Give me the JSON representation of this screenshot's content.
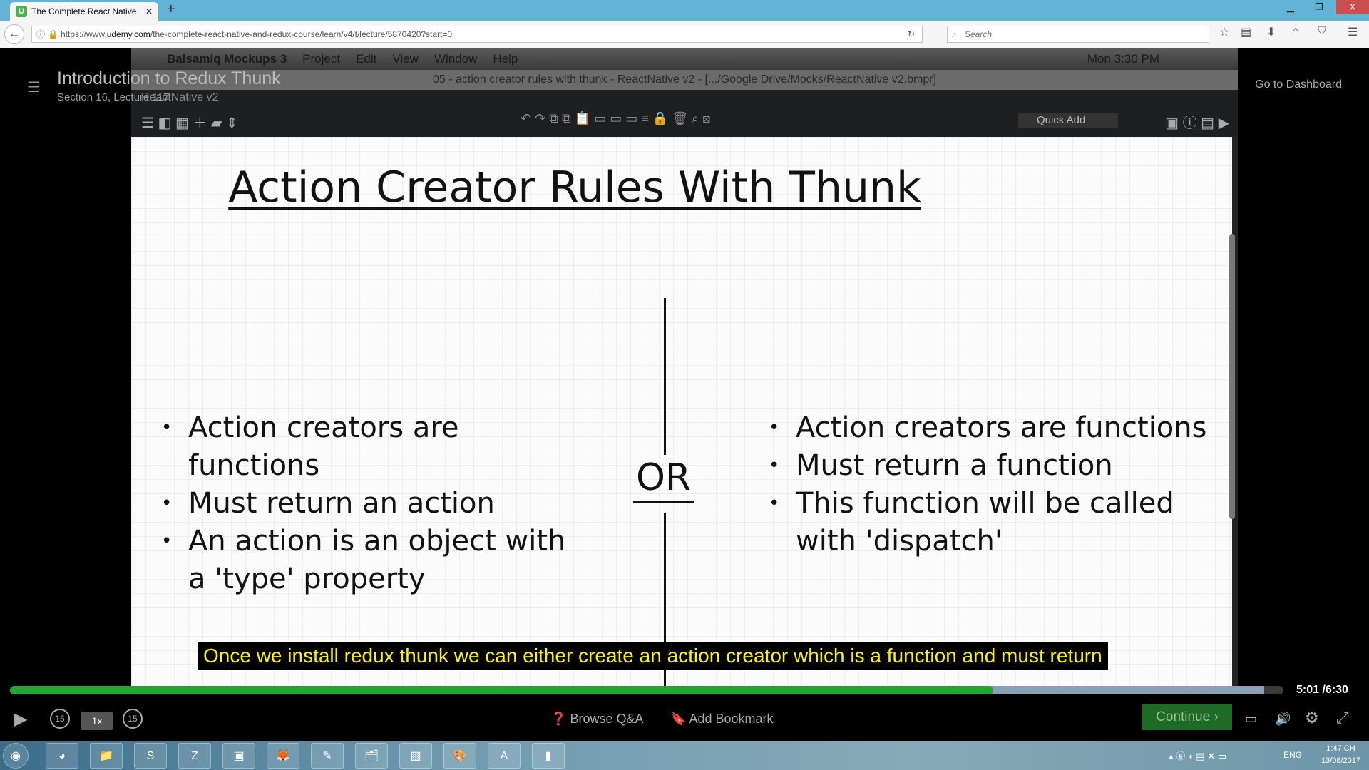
{
  "browser": {
    "tab_title": "The Complete React Native",
    "new_tab": "+",
    "url_prefix": "https://www.",
    "url_domain": "udemy.com",
    "url_path": "/the-complete-react-native-and-redux-course/learn/v4/t/lecture/5870420?start=0",
    "search_placeholder": "Search",
    "close": "X"
  },
  "course": {
    "lesson_title": "Introduction to Redux Thunk",
    "section": "Section 16, Lecture 117",
    "go_dashboard": "Go to Dashboard"
  },
  "mac": {
    "apple": "",
    "app": "Balsamiq Mockups 3",
    "menus": [
      "Project",
      "Edit",
      "View",
      "Window",
      "Help"
    ],
    "clock": "Mon 3:30 PM",
    "window_title": "05 - action creator rules with thunk - ReactNative v2 - [.../Google Drive/Mocks/ReactNative v2.bmpr]",
    "project_name": "ReactNative v2",
    "quick_add": "Quick Add"
  },
  "slide": {
    "title": "Action Creator Rules With Thunk",
    "or": "OR",
    "left": [
      "Action creators are functions",
      "Must return an action",
      "An action is an object with a 'type' property"
    ],
    "right": [
      "Action creators are functions",
      "Must return a function",
      "This function will be called with 'dispatch'"
    ]
  },
  "player": {
    "subtitle": "Once we install redux thunk we can either create an action creator which is a function and must return",
    "current_time": "5:01",
    "duration": "/6:30",
    "played_fraction": 0.772,
    "buffered_fraction": 0.985,
    "speed": "1x",
    "rewind": "15",
    "forward": "15",
    "browse_qa": "Browse Q&A",
    "add_bookmark": "Add Bookmark",
    "continue": "Continue"
  },
  "taskbar": {
    "apps": [
      "chrome",
      "explorer",
      "skype",
      "zalo",
      "hub",
      "firefox",
      "notepad",
      "files",
      "photos",
      "paint",
      "android-studio",
      "terminal"
    ],
    "lang": "ENG",
    "time": "1:47 CH",
    "date": "13/08/2017"
  }
}
